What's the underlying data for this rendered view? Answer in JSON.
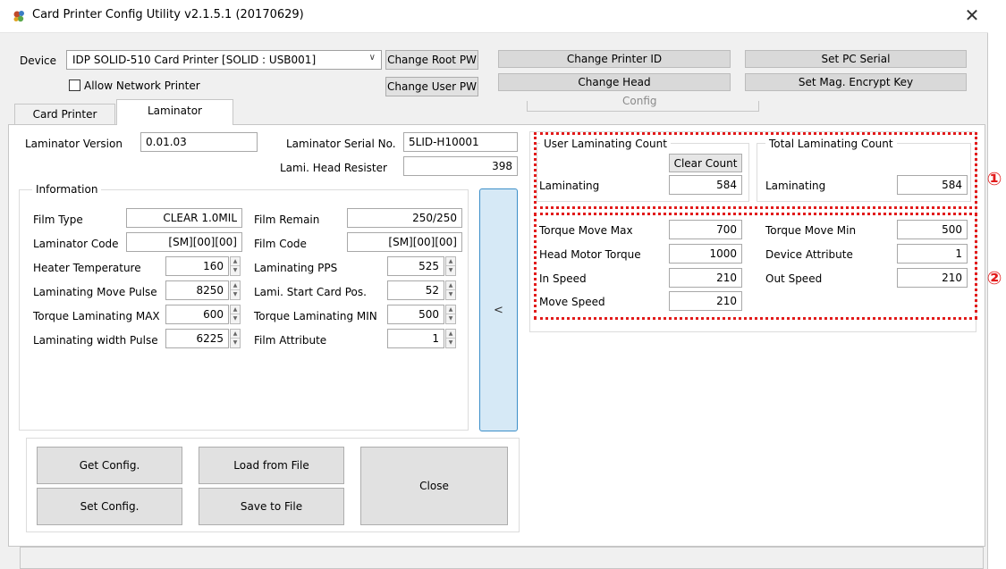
{
  "window": {
    "title": "Card Printer Config Utility v2.1.5.1 (20170629)",
    "close_glyph": "✕"
  },
  "top": {
    "device_label": "Device",
    "device_value": "IDP SOLID-510 Card Printer  [SOLID : USB001]",
    "allow_network_label": "Allow Network Printer",
    "allow_network_checked": false,
    "change_root_pw": "Change Root PW",
    "change_user_pw": "Change User PW",
    "change_printer_id": "Change Printer ID",
    "change_head": "Change Head",
    "set_pc_serial": "Set PC Serial",
    "set_mag_encrypt_key": "Set Mag. Encrypt Key",
    "config_group_label": "Config"
  },
  "tabs": [
    {
      "label": "Card Printer",
      "active": false
    },
    {
      "label": "Laminator",
      "active": true
    }
  ],
  "laminator": {
    "version_label": "Laminator Version",
    "version_value": "0.01.03",
    "serial_label": "Laminator Serial No.",
    "serial_value": "5LID-H10001",
    "head_resister_label": "Lami. Head Resister",
    "head_resister_value": "398"
  },
  "information": {
    "title": "Information",
    "film_type_label": "Film Type",
    "film_type_value": "CLEAR 1.0MIL",
    "film_remain_label": "Film Remain",
    "film_remain_value": "250/250",
    "lam_code_label": "Laminator Code",
    "lam_code_value": "[SM][00][00]",
    "film_code_label": "Film Code",
    "film_code_value": "[SM][00][00]",
    "heater_temp_label": "Heater Temperature",
    "heater_temp_value": "160",
    "lam_pps_label": "Laminating PPS",
    "lam_pps_value": "525",
    "lam_move_pulse_label": "Laminating Move Pulse",
    "lam_move_pulse_value": "8250",
    "lami_start_label": "Lami. Start Card Pos.",
    "lami_start_value": "52",
    "torque_lam_max_label": "Torque Laminating MAX",
    "torque_lam_max_value": "600",
    "torque_lam_min_label": "Torque Laminating MIN",
    "torque_lam_min_value": "500",
    "lam_width_pulse_label": "Laminating width Pulse",
    "lam_width_pulse_value": "6225",
    "film_attr_label": "Film Attribute",
    "film_attr_value": "1"
  },
  "arrow_button": "<",
  "counts": {
    "user_title": "User Laminating Count",
    "clear_count": "Clear Count",
    "user_lam_label": "Laminating",
    "user_lam_value": "584",
    "total_title": "Total Laminating Count",
    "total_lam_label": "Laminating",
    "total_lam_value": "584"
  },
  "motor": {
    "torque_move_max_label": "Torque Move Max",
    "torque_move_max_value": "700",
    "torque_move_min_label": "Torque Move Min",
    "torque_move_min_value": "500",
    "head_motor_torque_label": "Head Motor Torque",
    "head_motor_torque_value": "1000",
    "device_attr_label": "Device Attribute",
    "device_attr_value": "1",
    "in_speed_label": "In Speed",
    "in_speed_value": "210",
    "out_speed_label": "Out Speed",
    "out_speed_value": "210",
    "move_speed_label": "Move Speed",
    "move_speed_value": "210"
  },
  "callouts": {
    "one": "①",
    "two": "②",
    "color": "#e21b1b"
  },
  "actions": {
    "get_config": "Get Config.",
    "set_config": "Set Config.",
    "load_from_file": "Load from File",
    "save_to_file": "Save to File",
    "close": "Close"
  }
}
